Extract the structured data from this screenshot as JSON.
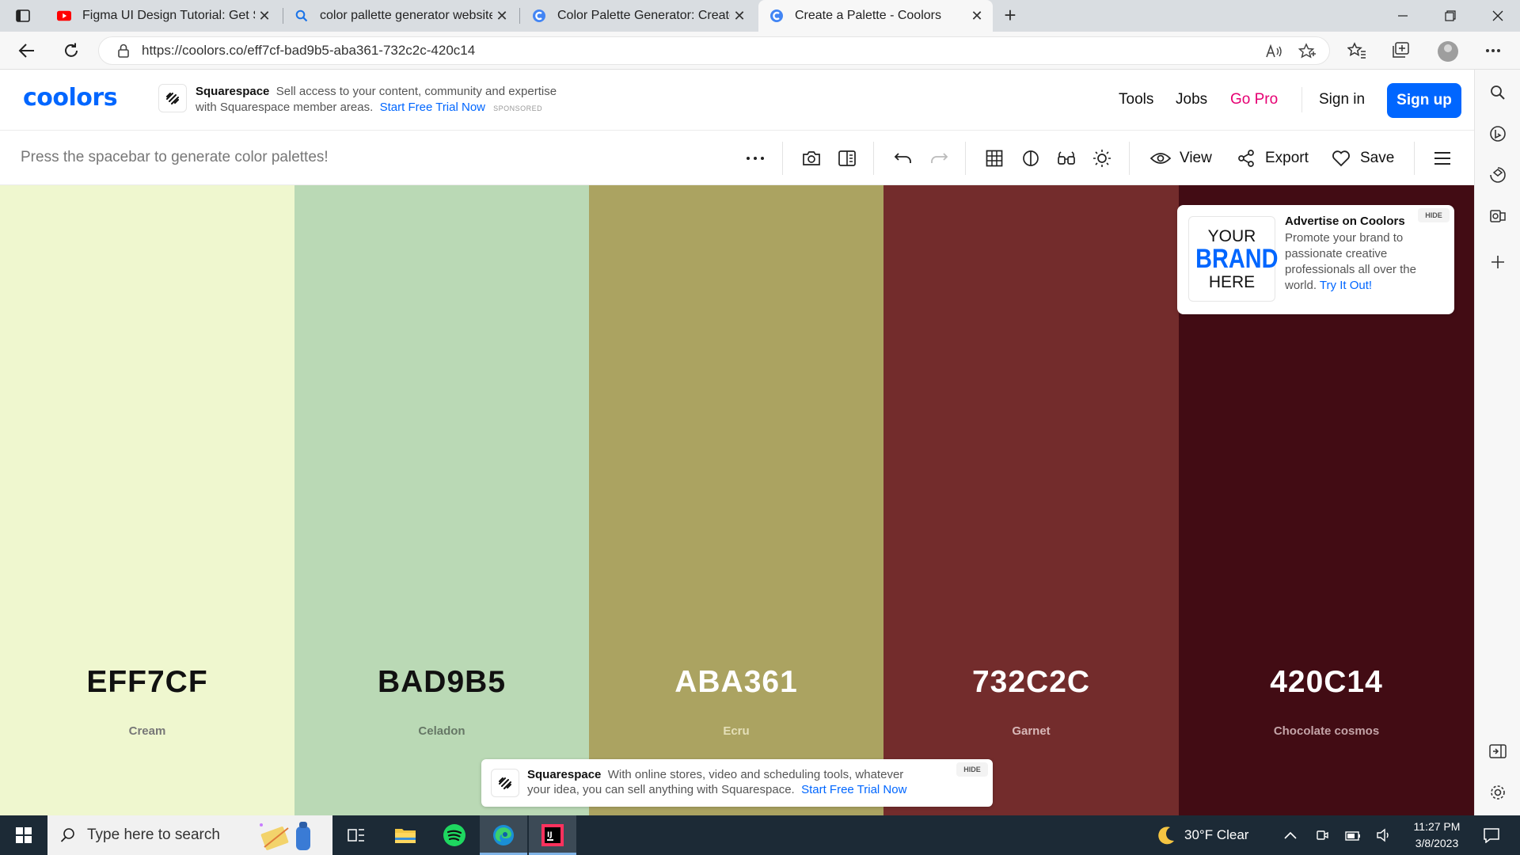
{
  "browser": {
    "tabs": [
      {
        "title": "Figma UI Design Tutorial: Get Sta",
        "favicon": "youtube-icon",
        "active": false
      },
      {
        "title": "color pallette generator website",
        "favicon": "search-icon",
        "active": false
      },
      {
        "title": "Color Palette Generator: Create B",
        "favicon": "coolors-favicon",
        "active": false
      },
      {
        "title": "Create a Palette - Coolors",
        "favicon": "coolors-favicon",
        "active": true
      }
    ],
    "url": "https://coolors.co/eff7cf-bad9b5-aba361-732c2c-420c14"
  },
  "header": {
    "logo": "coolors",
    "sponsor": {
      "name": "Squarespace",
      "line1": "Sell access to your content, community and expertise",
      "line2": "with Squarespace member areas.",
      "cta": "Start Free Trial Now",
      "tag": "SPONSORED"
    },
    "nav": {
      "tools": "Tools",
      "jobs": "Jobs",
      "pro": "Go Pro",
      "signin": "Sign in",
      "signup": "Sign up"
    }
  },
  "toolbar": {
    "hint": "Press the spacebar to generate color palettes!",
    "view": "View",
    "export": "Export",
    "save": "Save"
  },
  "palette": [
    {
      "hex": "EFF7CF",
      "name": "Cream",
      "color": "#EFF7CF",
      "text": "#111111",
      "sub": "#777777"
    },
    {
      "hex": "BAD9B5",
      "name": "Celadon",
      "color": "#BAD9B5",
      "text": "#111111",
      "sub": "#667766"
    },
    {
      "hex": "ABA361",
      "name": "Ecru",
      "color": "#ABA361",
      "text": "#ffffff",
      "sub": "#e4dfb8"
    },
    {
      "hex": "732C2C",
      "name": "Garnet",
      "color": "#732C2C",
      "text": "#ffffff",
      "sub": "#d8b8b8"
    },
    {
      "hex": "420C14",
      "name": "Chocolate cosmos",
      "color": "#420C14",
      "text": "#ffffff",
      "sub": "#c4a4a8"
    }
  ],
  "advert": {
    "brand1": "YOUR",
    "brand2": "BRAND",
    "brand3": "HERE",
    "title": "Advertise on Coolors",
    "body": "Promote your brand to passionate creative professionals all over the world.",
    "cta": "Try It Out!",
    "hide": "HIDE"
  },
  "bottom_ad": {
    "name": "Squarespace",
    "line1": "With online stores, video and scheduling tools, whatever",
    "line2": "your idea, you can sell anything with Squarespace.",
    "cta": "Start Free Trial Now",
    "hide": "HIDE"
  },
  "taskbar": {
    "search_placeholder": "Type here to search",
    "weather": "30°F  Clear",
    "time": "11:27 PM",
    "date": "3/8/2023"
  },
  "colors": {
    "accent": "#0066ff",
    "pro": "#e60073"
  }
}
